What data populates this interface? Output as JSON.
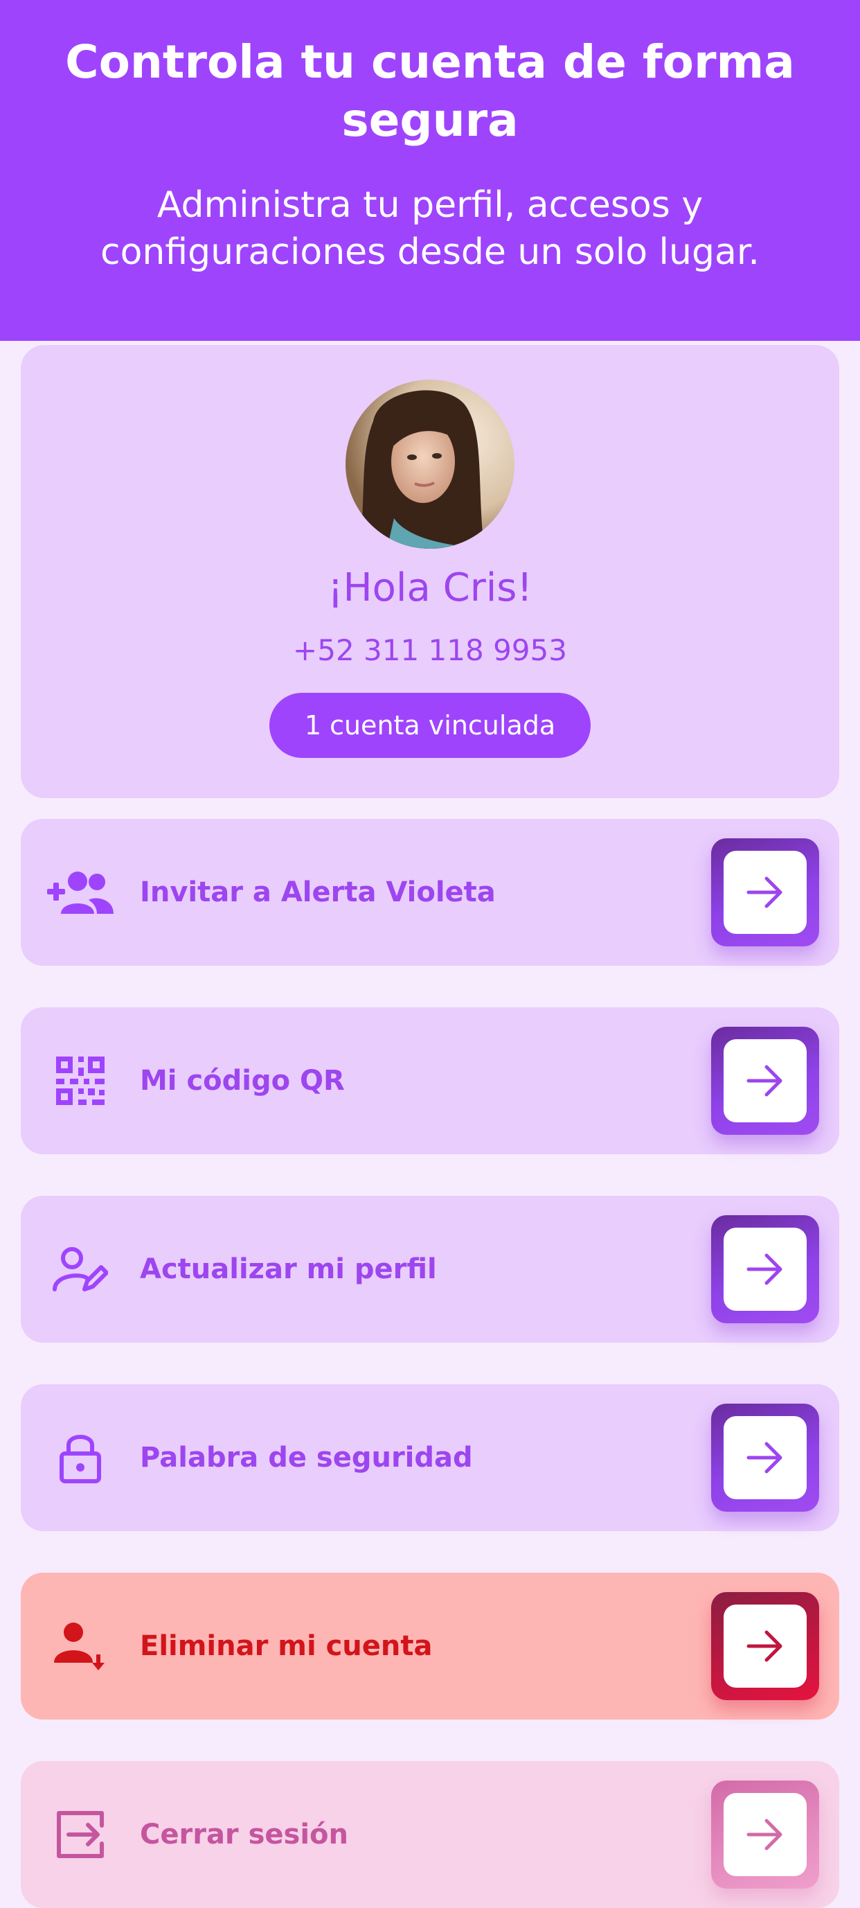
{
  "header": {
    "title": "Controla tu cuenta de forma segura",
    "subtitle": "Administra tu perfil, accesos y configuraciones desde un solo lugar."
  },
  "profile": {
    "greeting": "¡Hola Cris!",
    "phone": "+52 311 118 9953",
    "linked_accounts_label": "1 cuenta vinculada"
  },
  "menu": {
    "items": [
      {
        "label": "Invitar a Alerta Violeta",
        "icon": "add-users-icon"
      },
      {
        "label": "Mi código QR",
        "icon": "qr-code-icon"
      },
      {
        "label": "Actualizar mi perfil",
        "icon": "user-edit-icon"
      },
      {
        "label": "Palabra de seguridad",
        "icon": "lock-icon"
      },
      {
        "label": "Eliminar mi cuenta",
        "icon": "user-remove-icon"
      },
      {
        "label": "Cerrar sesión",
        "icon": "logout-icon"
      }
    ]
  },
  "colors": {
    "primary": "#9f44fd",
    "card": "#e8cdfd",
    "danger_bg": "#feb6b4",
    "danger_text": "#d2141b",
    "logout_bg": "#f7d2e8",
    "logout_text": "#c5559f"
  }
}
